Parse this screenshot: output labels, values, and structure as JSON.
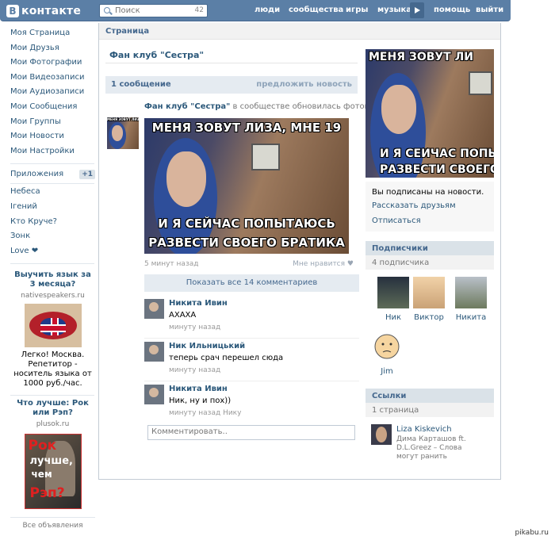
{
  "header": {
    "logo_letter": "В",
    "logo_text": "контакте",
    "search_placeholder": "Поиск",
    "search_count": "42",
    "nav": [
      "люди",
      "сообщества",
      "игры",
      "музыка",
      "помощь",
      "выйти"
    ]
  },
  "left_menu": {
    "items": [
      "Моя Страница",
      "Мои Друзья",
      "Мои Фотографии",
      "Мои Видеозаписи",
      "Мои Аудиозаписи",
      "Мои Сообщения",
      "Мои Группы",
      "Мои Новости",
      "Мои Настройки"
    ],
    "apps_label": "Приложения",
    "apps_badge": "+1",
    "apps": [
      "Небеса",
      "Iгений",
      "Кто Круче?",
      "Зонк",
      "Love"
    ]
  },
  "ads": [
    {
      "title": "Выучить язык за 3 месяца?",
      "domain": "nativespeakers.ru",
      "text": "Легко! Москва. Репетитор - носитель языка от 1000 руб./час."
    },
    {
      "title": "Что лучше: Рок или Рэп?",
      "domain": "plusok.ru",
      "image_words": [
        "Рок",
        "лучше,",
        "чем",
        "Рэп?"
      ]
    }
  ],
  "all_ads": "Все объявления",
  "page": {
    "header": "Страница",
    "group_title": "Фан клуб \"Сестра\"",
    "messages_count": "1 сообщение",
    "suggest_news": "предложить новость"
  },
  "post": {
    "author": "Фан клуб \"Сестра\"",
    "action": "в сообществе обновилась фотография",
    "meme_top": "МЕНЯ ЗОВУТ ЛИЗА, МНЕ 19",
    "meme_bottom_1": "И Я СЕЙЧАС ПОПЫТАЮСЬ",
    "meme_bottom_2": "РАЗВЕСТИ СВОЕГО БРАТИКА",
    "time": "5 минут назад",
    "like": "Мне нравится",
    "show_comments": "Показать все 14 комментариев"
  },
  "comments": [
    {
      "name": "Никита Ивин",
      "text": "АХАХА",
      "time": "минуту назад"
    },
    {
      "name": "Ник Ильницький",
      "text": "теперь срач перешел сюда",
      "time": "минуту назад"
    },
    {
      "name": "Никита Ивин",
      "text": "Ник, ну и пох))",
      "time": "минуту назад Нику"
    }
  ],
  "comment_placeholder": "Комментировать..",
  "right": {
    "photo_top": "МЕНЯ ЗОВУТ ЛИ",
    "photo_bottom_1": "И Я СЕЙЧАС ПОПЫ",
    "photo_bottom_2": "РАЗВЕСТИ СВОЕГО",
    "subscribed": "Вы подписаны на новости.",
    "tell_friends": "Рассказать друзьям",
    "unsubscribe": "Отписаться",
    "subscribers_header": "Подписчики",
    "subscribers_count": "4 подписчика",
    "members": [
      "Ник",
      "Виктор",
      "Никита",
      "Jim"
    ],
    "links_header": "Ссылки",
    "links_count": "1 страница",
    "link_title": "Liza Kiskevich",
    "link_desc": "Дима Карташов ft. D.L.Greez – Слова могут ранить"
  },
  "watermark": "pikabu.ru",
  "colors": {
    "header_blue": "#5b7fa6",
    "link_blue": "#2b587a",
    "bar_blue": "#e5ebf1"
  }
}
